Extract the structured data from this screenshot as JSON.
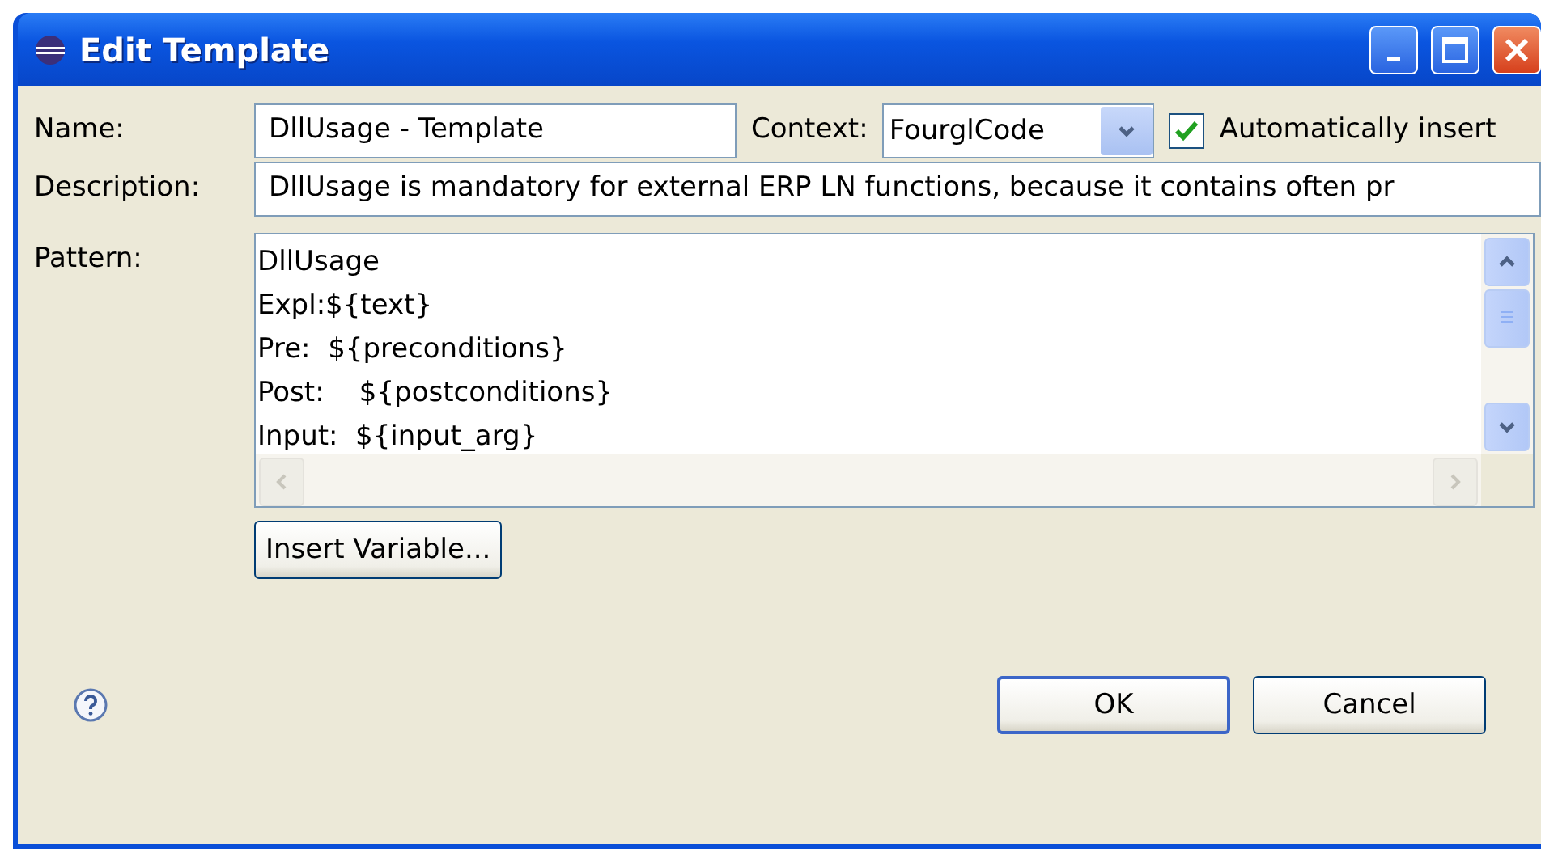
{
  "window": {
    "title": "Edit Template"
  },
  "name": {
    "label": "Name:",
    "value": "DllUsage - Template"
  },
  "context": {
    "label": "Context:",
    "value": "FourglCode"
  },
  "auto_insert": {
    "label": "Automatically insert",
    "checked": true
  },
  "description": {
    "label": "Description:",
    "value": "DllUsage is mandatory for external ERP LN functions, because it contains often pr"
  },
  "pattern": {
    "label": "Pattern:",
    "lines": [
      "DllUsage",
      "Expl:${text}",
      "Pre:  ${preconditions}",
      "Post:    ${postconditions}",
      "Input:  ${input_arg}"
    ]
  },
  "insert_variable": {
    "label": "Insert Variable..."
  },
  "buttons": [
    {
      "label": "OK",
      "default": true
    },
    {
      "label": "Cancel",
      "default": false
    }
  ]
}
